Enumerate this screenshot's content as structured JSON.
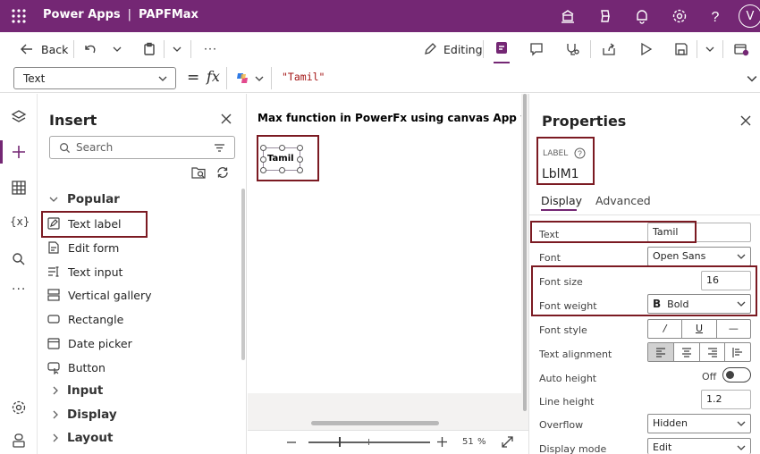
{
  "header": {
    "app_name": "Power Apps",
    "separator": "|",
    "app_title": "PAPFMax",
    "avatar_letter": "V",
    "bg": "#742774"
  },
  "command": {
    "back_label": "Back",
    "more_label": "···",
    "editing_label": "Editing"
  },
  "formula": {
    "property": "Text",
    "equals": "=",
    "fx": "fx",
    "value": "\"Tamil\""
  },
  "insert_pane": {
    "title": "Insert",
    "search_placeholder": "Search",
    "categories": [
      "Popular",
      "Input",
      "Display",
      "Layout"
    ],
    "items": [
      "Text label",
      "Edit form",
      "Text input",
      "Vertical gallery",
      "Rectangle",
      "Date picker",
      "Button"
    ]
  },
  "canvas": {
    "title": "Max function in  PowerFx using canvas App with Po",
    "label_text": "Tamil",
    "zoom": "51",
    "zoom_unit": "%",
    "zoom_fraction": 0.51
  },
  "properties": {
    "title": "Properties",
    "control_type": "LABEL",
    "control_name": "LblM1",
    "tabs": [
      "Display",
      "Advanced"
    ],
    "rows": {
      "text": {
        "label": "Text",
        "value": "Tamil"
      },
      "font": {
        "label": "Font",
        "value": "Open Sans"
      },
      "font_size": {
        "label": "Font size",
        "value": "16"
      },
      "font_weight": {
        "label": "Font weight",
        "value": "Bold",
        "icon": "B"
      },
      "font_style": {
        "label": "Font style",
        "buttons": [
          "/",
          "U",
          "—"
        ]
      },
      "text_alignment": {
        "label": "Text alignment"
      },
      "auto_height": {
        "label": "Auto height",
        "value": "Off"
      },
      "line_height": {
        "label": "Line height",
        "value": "1.2"
      },
      "overflow": {
        "label": "Overflow",
        "value": "Hidden"
      },
      "display_mode": {
        "label": "Display mode",
        "value": "Edit"
      }
    }
  },
  "colors": {
    "highlight": "#7b1a22",
    "accent": "#742774"
  }
}
